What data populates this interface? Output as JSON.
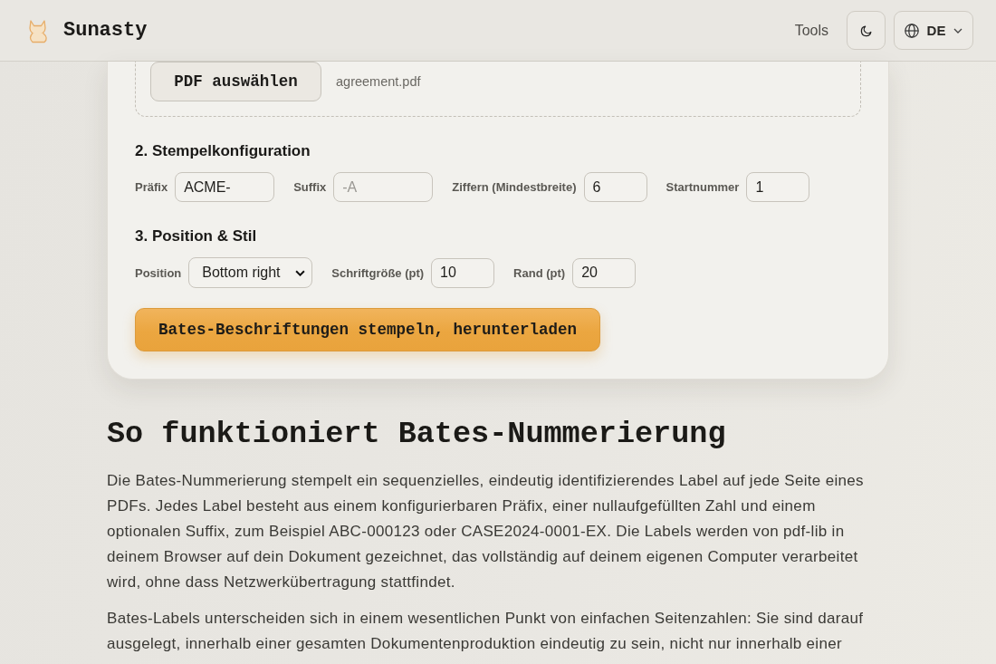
{
  "header": {
    "brand": "Sunasty",
    "nav_link": "Tools",
    "language": "DE"
  },
  "upload": {
    "button": "PDF auswählen",
    "file_name": "agreement.pdf"
  },
  "sections": [
    {
      "title": "2. Stempelkonfiguration",
      "fields": [
        {
          "kind": "text",
          "label": "Präfix",
          "value": "ACME-"
        },
        {
          "kind": "text",
          "label": "Suffix",
          "placeholder": "-A"
        },
        {
          "kind": "number",
          "label": "Ziffern (Mindestbreite)",
          "value": "6"
        },
        {
          "kind": "number",
          "label": "Startnummer",
          "value": "1"
        }
      ]
    },
    {
      "title": "3. Position & Stil",
      "fields": [
        {
          "kind": "select",
          "label": "Position",
          "value": "Bottom right"
        },
        {
          "kind": "number",
          "label": "Schriftgröße (pt)",
          "value": "10"
        },
        {
          "kind": "number",
          "label": "Rand (pt)",
          "value": "20"
        }
      ]
    }
  ],
  "submit_button": "Bates-Beschriftungen stempeln, herunterladen",
  "article": {
    "heading": "So funktioniert Bates-Nummerierung",
    "paragraphs": [
      "Die Bates-Nummerierung stempelt ein sequenzielles, eindeutig identifizierendes Label auf jede Seite eines PDFs. Jedes Label besteht aus einem konfigurierbaren Präfix, einer nullaufgefüllten Zahl und einem optionalen Suffix, zum Beispiel ABC-000123 oder CASE2024-0001-EX. Die Labels werden von pdf-lib in deinem Browser auf dein Dokument gezeichnet, das vollständig auf deinem eigenen Computer verarbeitet wird, ohne dass Netzwerkübertragung stattfindet.",
      "Bates-Labels unterscheiden sich in einem wesentlichen Punkt von einfachen Seitenzahlen: Sie sind darauf ausgelegt, innerhalb einer gesamten Dokumentenproduktion eindeutig zu sein, nicht nur innerhalb einer"
    ]
  }
}
